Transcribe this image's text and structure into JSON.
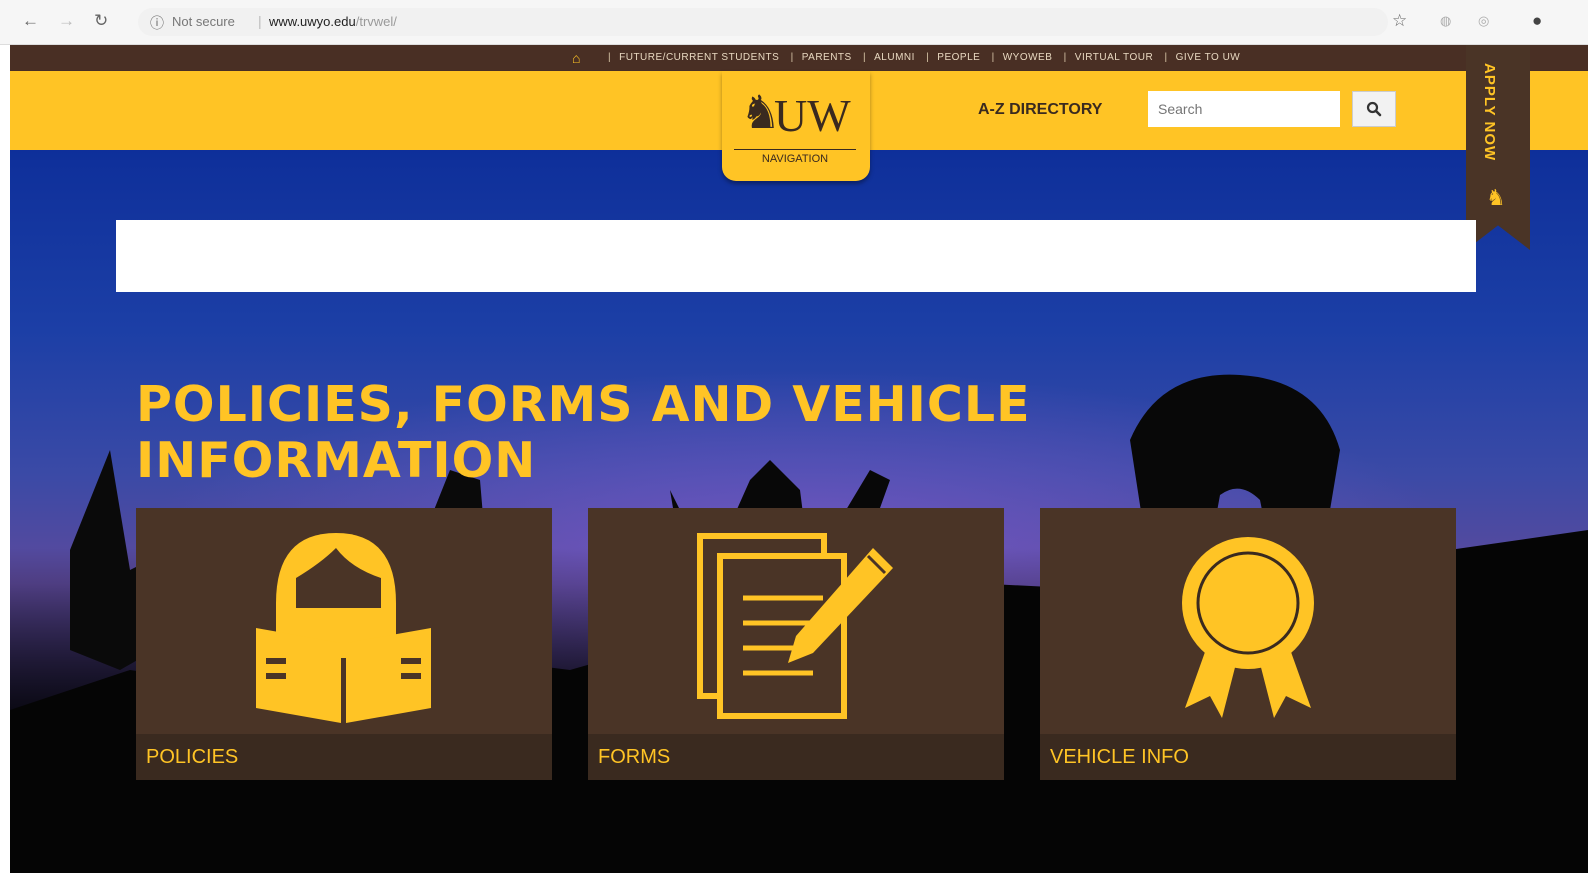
{
  "browser": {
    "security_label": "Not secure",
    "url_host": "www.uwyo.edu",
    "url_path": "/trvwel/"
  },
  "topnav": {
    "links": [
      "FUTURE/CURRENT STUDENTS",
      "PARENTS",
      "ALUMNI",
      "PEOPLE",
      "WYOWEB",
      "VIRTUAL TOUR",
      "GIVE TO UW"
    ]
  },
  "header": {
    "logo_text": "UW",
    "logo_subtitle": "NAVIGATION",
    "az_directory": "A-Z DIRECTORY",
    "search_placeholder": "Search",
    "apply_now": "APPLY NOW"
  },
  "main": {
    "title": "POLICIES, FORMS AND VEHICLE INFORMATION",
    "cards": [
      {
        "label": "POLICIES",
        "icon": "reading-person-icon"
      },
      {
        "label": "FORMS",
        "icon": "forms-pencil-icon"
      },
      {
        "label": "VEHICLE INFO",
        "icon": "award-ribbon-icon"
      }
    ]
  },
  "colors": {
    "gold": "#ffc425",
    "brown": "#4a3426",
    "dark_brown": "#3a2a1f"
  }
}
